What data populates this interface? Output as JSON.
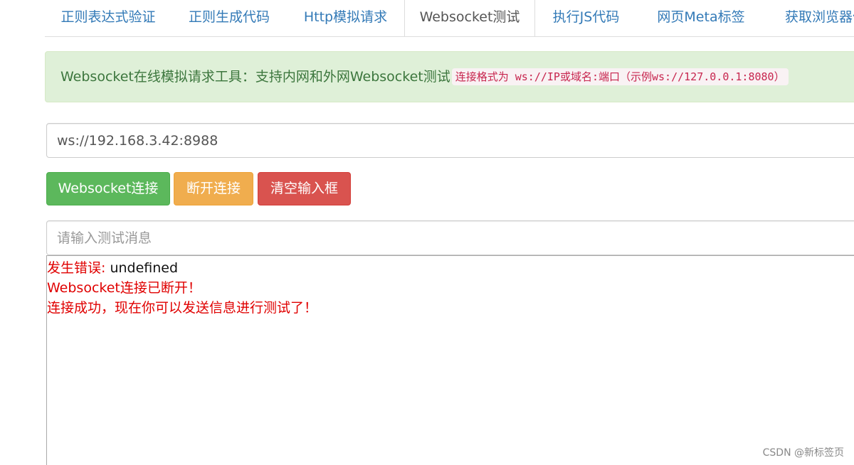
{
  "tabs": [
    {
      "label": "正则表达式验证"
    },
    {
      "label": "正则生成代码"
    },
    {
      "label": "Http模拟请求"
    },
    {
      "label": "Websocket测试"
    },
    {
      "label": "执行JS代码"
    },
    {
      "label": "网页Meta标签"
    },
    {
      "label": "获取浏览器信"
    }
  ],
  "active_tab": "Websocket测试",
  "alert": {
    "text": "Websocket在线模拟请求工具：支持内网和外网Websocket测试",
    "code": "连接格式为 ws://IP或域名:端口（示例ws://127.0.0.1:8080）"
  },
  "url_input": {
    "value": "ws://192.168.3.42:8988"
  },
  "buttons": {
    "connect": "Websocket连接",
    "disconnect": "断开连接",
    "clear": "清空输入框"
  },
  "message_input": {
    "placeholder": "请输入测试消息"
  },
  "log": {
    "error_prefix": "发生错误:",
    "error_value": " undefined",
    "disconnected": "Websocket连接已断开！",
    "connected": "连接成功，现在你可以发送信息进行测试了！"
  },
  "watermark": "CSDN @新标签页",
  "colors": {
    "tab_link": "#337ab7",
    "alert_bg": "#dff0d8",
    "alert_text": "#3c763d",
    "code_text": "#c7254e",
    "success": "#5cb85c",
    "warning": "#f0ad4e",
    "danger": "#d9534f",
    "log_red": "#e00000"
  }
}
